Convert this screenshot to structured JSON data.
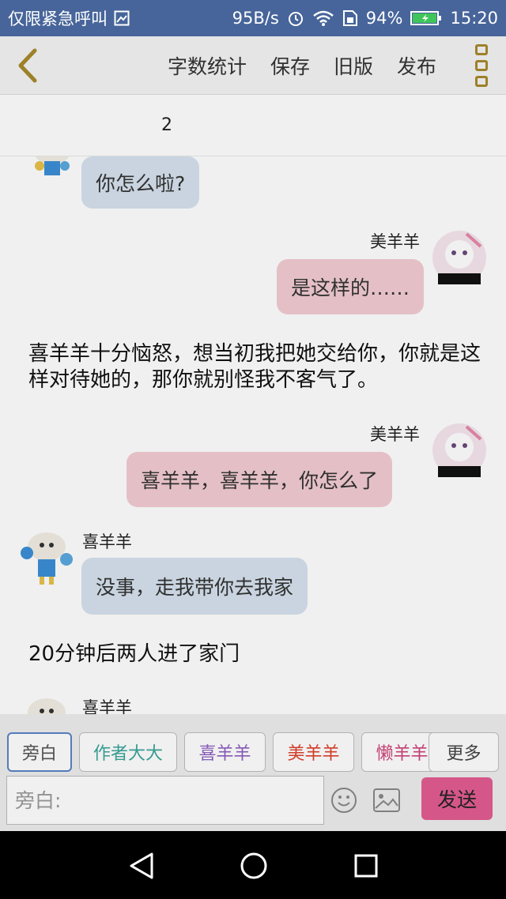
{
  "status_bar": {
    "carrier": "仅限紧急呼叫",
    "net_speed": "95B/s",
    "battery": "94%",
    "time": "15:20"
  },
  "toolbar": {
    "actions": [
      "字数统计",
      "保存",
      "旧版",
      "发布"
    ]
  },
  "chapter": {
    "number": "2"
  },
  "messages": [
    {
      "type": "left",
      "speaker": "",
      "text": "你怎么啦?"
    },
    {
      "type": "right",
      "speaker": "美羊羊",
      "text": "是这样的……"
    },
    {
      "type": "narration",
      "text": "喜羊羊十分恼怒，想当初我把她交给你，你就是这样对待她的，那你就别怪我不客气了。"
    },
    {
      "type": "right",
      "speaker": "美羊羊",
      "text": "喜羊羊，喜羊羊，你怎么了"
    },
    {
      "type": "left",
      "speaker": "喜羊羊",
      "text": "没事，走我带你去我家"
    },
    {
      "type": "narration",
      "text": "20分钟后两人进了家门"
    },
    {
      "type": "left",
      "speaker": "喜羊羊",
      "text": ""
    }
  ],
  "character_tabs": [
    {
      "label": "旁白",
      "color": "#555555",
      "selected": true
    },
    {
      "label": "作者大大",
      "color": "#3aa59a",
      "selected": false
    },
    {
      "label": "喜羊羊",
      "color": "#8e5fc2",
      "selected": false
    },
    {
      "label": "美羊羊",
      "color": "#e0412d",
      "selected": false
    },
    {
      "label": "懒羊羊",
      "color": "#d1457d",
      "selected": false
    }
  ],
  "more_tab_label": "更多",
  "input": {
    "placeholder": "旁白:"
  },
  "send_label": "发送",
  "icons": {
    "back": "chevron-left-icon",
    "menu": "more-vertical-icon",
    "emoji": "smiley-icon",
    "image": "image-icon"
  },
  "colors": {
    "status_bar": "#47659a",
    "left_bubble": "#d6e2ee",
    "right_bubble": "#f3ccd3",
    "send_button": "#e35d92",
    "back_icon": "#a78a2c"
  }
}
